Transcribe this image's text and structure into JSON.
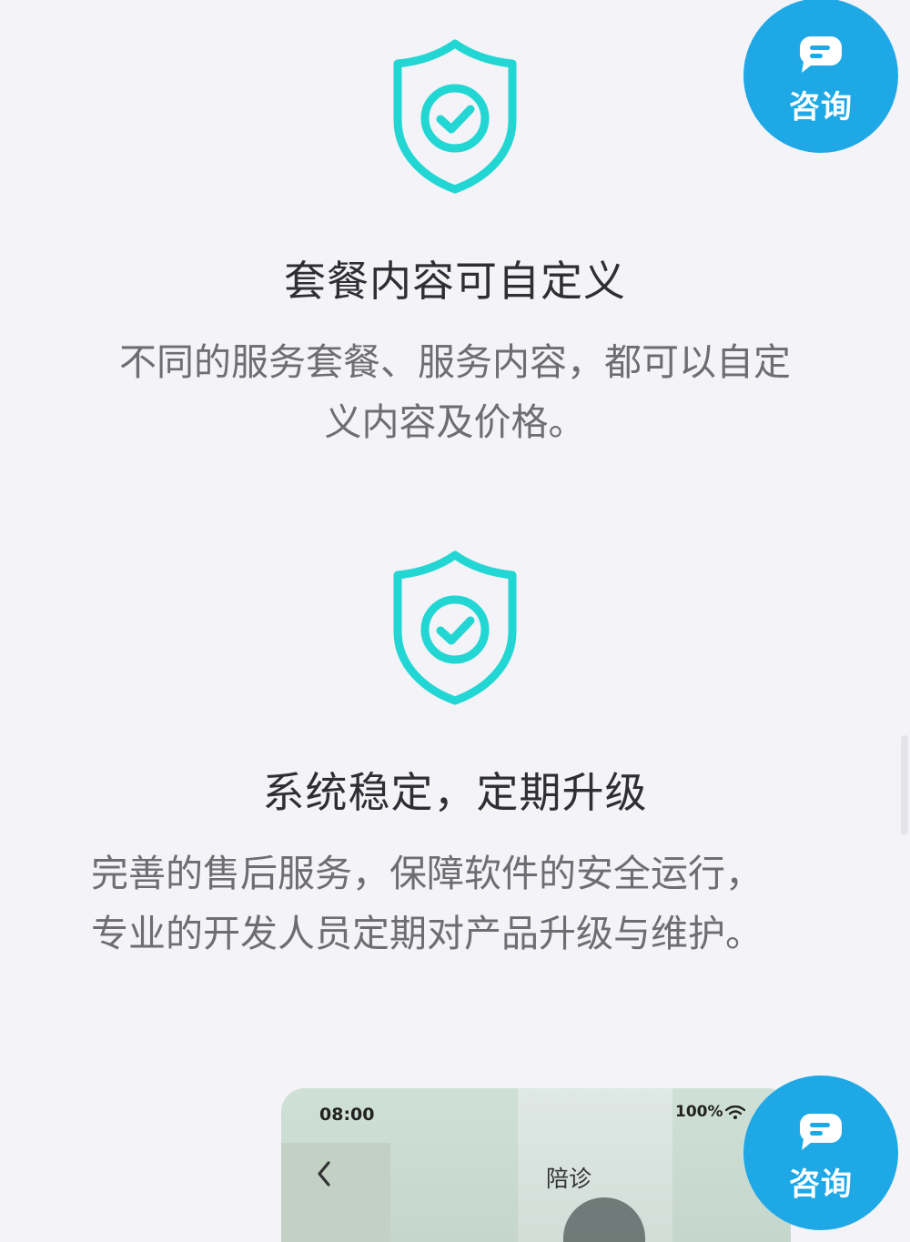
{
  "features": [
    {
      "icon": "shield-check-icon",
      "title": "套餐内容可自定义",
      "desc_lines": [
        "不同的服务套餐、服务内容，都可以自定",
        "义内容及价格。"
      ]
    },
    {
      "icon": "shield-check-icon",
      "title": "系统稳定，定期升级",
      "desc_lines": [
        "完善的售后服务，保障软件的安全运行，",
        "专业的开发人员定期对产品升级与维护。"
      ]
    }
  ],
  "consult_button": {
    "label": "咨询",
    "icon": "chat-bubble-icon",
    "color": "#1fa8e6"
  },
  "phone_preview": {
    "time": "08:00",
    "battery": "100%",
    "title": "陪诊",
    "back_icon": "chevron-left-icon",
    "wifi_icon": "wifi-icon"
  },
  "colors": {
    "accent_teal": "#22d6d3",
    "background": "#f3f3f8"
  }
}
